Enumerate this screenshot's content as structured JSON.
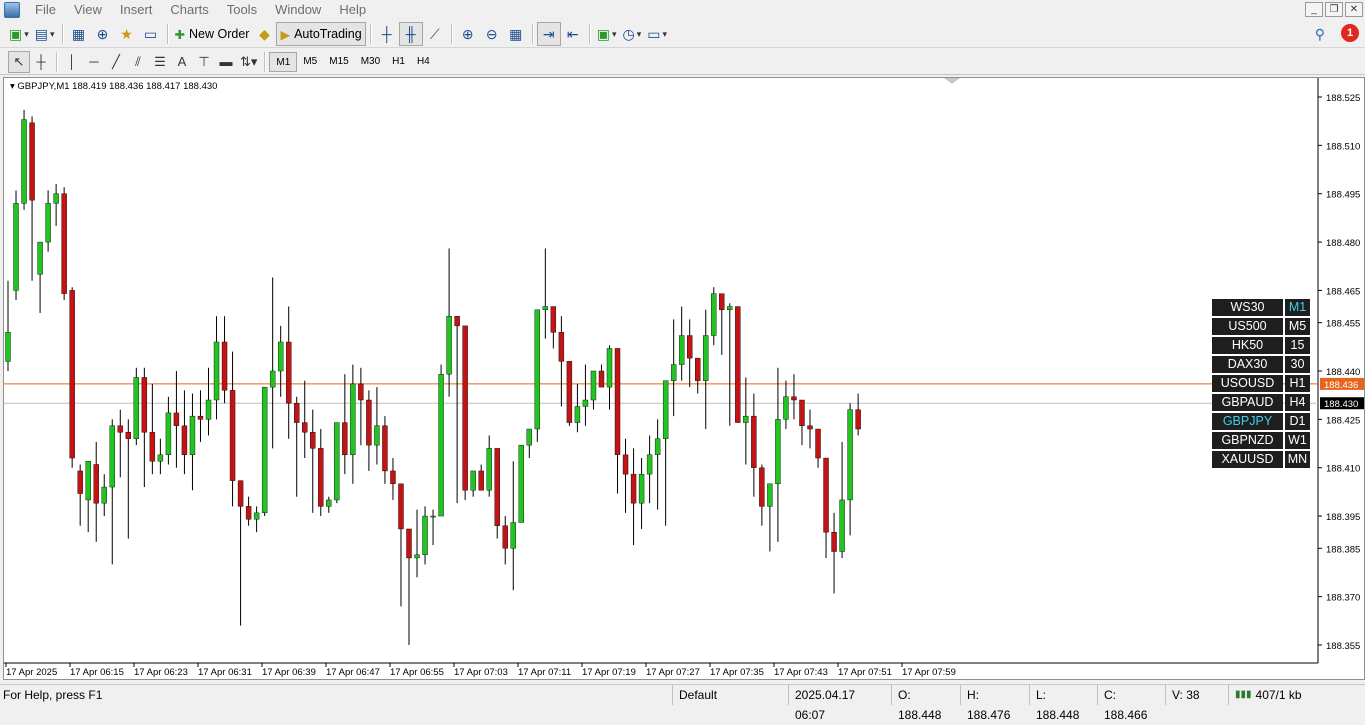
{
  "menu": [
    "File",
    "View",
    "Insert",
    "Charts",
    "Tools",
    "Window",
    "Help"
  ],
  "toolbar": {
    "new_order_label": "New Order",
    "autotrading_label": "AutoTrading",
    "alerts_count": "1"
  },
  "timeframes_toolbar": [
    "M1",
    "M5",
    "M15",
    "M30",
    "H1",
    "H4"
  ],
  "chart": {
    "title": "GBPJPY,M1  188.419 188.436 188.417 188.430",
    "bid_label": "188.436",
    "last_label": "188.430"
  },
  "chart_data": {
    "type": "candlestick",
    "symbol": "GBPJPY",
    "timeframe": "M1",
    "ohlc_header": {
      "open": 188.419,
      "high": 188.436,
      "low": 188.417,
      "close": 188.43
    },
    "y_ticks": [
      "188.525",
      "188.510",
      "188.495",
      "188.480",
      "188.465",
      "188.455",
      "188.440",
      "188.425",
      "188.410",
      "188.395",
      "188.385",
      "188.370",
      "188.355"
    ],
    "y_tick_values": [
      188.525,
      188.51,
      188.495,
      188.48,
      188.465,
      188.455,
      188.44,
      188.425,
      188.41,
      188.395,
      188.385,
      188.37,
      188.355
    ],
    "x_ticks": [
      "17 Apr 2025",
      "17 Apr 06:15",
      "17 Apr 06:23",
      "17 Apr 06:31",
      "17 Apr 06:39",
      "17 Apr 06:47",
      "17 Apr 06:55",
      "17 Apr 07:03",
      "17 Apr 07:11",
      "17 Apr 07:19",
      "17 Apr 07:27",
      "17 Apr 07:35",
      "17 Apr 07:43",
      "17 Apr 07:51",
      "17 Apr 07:59"
    ],
    "horizontal_lines": [
      {
        "name": "bid",
        "value": 188.436,
        "color": "#e8641e"
      },
      {
        "name": "last",
        "value": 188.43,
        "color": "#c0c0c0"
      }
    ],
    "colors": {
      "bull": "#22c422",
      "bear": "#c21414",
      "wick": "#000000"
    },
    "candles": [
      [
        188.443,
        188.468,
        188.452,
        188.44
      ],
      [
        188.465,
        188.496,
        188.492,
        188.462
      ],
      [
        188.492,
        188.521,
        188.518,
        188.49
      ],
      [
        188.517,
        188.519,
        188.493,
        188.468
      ],
      [
        188.47,
        188.479,
        188.48,
        188.458
      ],
      [
        188.48,
        188.496,
        188.492,
        188.477
      ],
      [
        188.492,
        188.498,
        188.495,
        188.485
      ],
      [
        188.495,
        188.497,
        188.464,
        188.462
      ],
      [
        188.465,
        188.466,
        188.413,
        188.41
      ],
      [
        188.409,
        188.411,
        188.402,
        188.392
      ],
      [
        188.4,
        188.412,
        188.412,
        188.39
      ],
      [
        188.411,
        188.418,
        188.399,
        188.387
      ],
      [
        188.399,
        188.408,
        188.404,
        188.395
      ],
      [
        188.404,
        188.425,
        188.423,
        188.38
      ],
      [
        188.423,
        188.428,
        188.421,
        188.407
      ],
      [
        188.421,
        188.425,
        188.419,
        188.388
      ],
      [
        188.419,
        188.441,
        188.438,
        188.417
      ],
      [
        188.438,
        188.441,
        188.421,
        188.404
      ],
      [
        188.421,
        188.436,
        188.412,
        188.408
      ],
      [
        188.412,
        188.419,
        188.414,
        188.408
      ],
      [
        188.414,
        188.432,
        188.427,
        188.411
      ],
      [
        188.427,
        188.44,
        188.423,
        188.41
      ],
      [
        188.423,
        188.434,
        188.414,
        188.408
      ],
      [
        188.414,
        188.433,
        188.426,
        188.403
      ],
      [
        188.426,
        188.434,
        188.425,
        188.418
      ],
      [
        188.425,
        188.441,
        188.431,
        188.42
      ],
      [
        188.431,
        188.457,
        188.449,
        188.425
      ],
      [
        188.449,
        188.457,
        188.434,
        188.43
      ],
      [
        188.434,
        188.446,
        188.406,
        188.398
      ],
      [
        188.406,
        188.405,
        188.398,
        188.361
      ],
      [
        188.398,
        188.401,
        188.394,
        188.392
      ],
      [
        188.394,
        188.398,
        188.396,
        188.39
      ],
      [
        188.396,
        188.423,
        188.435,
        188.395
      ],
      [
        188.435,
        188.469,
        188.44,
        188.416
      ],
      [
        188.44,
        188.454,
        188.449,
        188.432
      ],
      [
        188.449,
        188.46,
        188.43,
        188.419
      ],
      [
        188.43,
        188.432,
        188.424,
        188.401
      ],
      [
        188.424,
        188.437,
        188.421,
        188.413
      ],
      [
        188.421,
        188.428,
        188.416,
        188.396
      ],
      [
        188.416,
        188.422,
        188.398,
        188.395
      ],
      [
        188.398,
        188.401,
        188.4,
        188.396
      ],
      [
        188.4,
        188.414,
        188.424,
        188.399
      ],
      [
        188.424,
        188.439,
        188.414,
        188.408
      ],
      [
        188.414,
        188.442,
        188.436,
        188.405
      ],
      [
        188.436,
        188.441,
        188.431,
        188.417
      ],
      [
        188.431,
        188.434,
        188.417,
        188.409
      ],
      [
        188.417,
        188.435,
        188.423,
        188.411
      ],
      [
        188.423,
        188.426,
        188.409,
        188.405
      ],
      [
        188.409,
        188.413,
        188.405,
        188.4
      ],
      [
        188.405,
        188.399,
        188.391,
        188.367
      ],
      [
        188.391,
        188.39,
        188.382,
        188.355
      ],
      [
        188.382,
        188.397,
        188.383,
        188.376
      ],
      [
        188.383,
        188.398,
        188.395,
        188.38
      ],
      [
        188.395,
        188.397,
        188.395,
        188.386
      ],
      [
        188.395,
        188.442,
        188.439,
        188.401
      ],
      [
        188.439,
        188.478,
        188.457,
        188.432
      ],
      [
        188.457,
        188.453,
        188.454,
        188.399
      ],
      [
        188.454,
        188.437,
        188.403,
        188.4
      ],
      [
        188.403,
        188.405,
        188.409,
        188.401
      ],
      [
        188.409,
        188.411,
        188.403,
        188.403
      ],
      [
        188.403,
        188.42,
        188.416,
        188.401
      ],
      [
        188.416,
        188.414,
        188.392,
        188.388
      ],
      [
        188.392,
        188.395,
        188.385,
        188.38
      ],
      [
        188.385,
        188.412,
        188.393,
        188.372
      ],
      [
        188.393,
        188.412,
        188.417,
        188.405
      ],
      [
        188.417,
        188.42,
        188.422,
        188.413
      ],
      [
        188.422,
        188.439,
        188.459,
        188.418
      ],
      [
        188.459,
        188.478,
        188.46,
        188.45
      ],
      [
        188.46,
        188.446,
        188.452,
        188.447
      ],
      [
        188.452,
        188.457,
        188.443,
        188.429
      ],
      [
        188.443,
        188.443,
        188.424,
        188.423
      ],
      [
        188.424,
        188.436,
        188.429,
        188.421
      ],
      [
        188.429,
        188.442,
        188.431,
        188.423
      ],
      [
        188.431,
        188.44,
        188.44,
        188.428
      ],
      [
        188.44,
        188.442,
        188.435,
        188.435
      ],
      [
        188.435,
        188.448,
        188.447,
        188.428
      ],
      [
        188.447,
        188.446,
        188.414,
        188.402
      ],
      [
        188.414,
        188.419,
        188.408,
        188.396
      ],
      [
        188.408,
        188.416,
        188.399,
        188.386
      ],
      [
        188.399,
        188.413,
        188.408,
        188.391
      ],
      [
        188.408,
        188.42,
        188.414,
        188.399
      ],
      [
        188.414,
        188.425,
        188.419,
        188.397
      ],
      [
        188.419,
        188.432,
        188.437,
        188.392
      ],
      [
        188.437,
        188.456,
        188.442,
        188.426
      ],
      [
        188.442,
        188.46,
        188.451,
        188.437
      ],
      [
        188.451,
        188.456,
        188.444,
        188.435
      ],
      [
        188.444,
        188.441,
        188.437,
        188.433
      ],
      [
        188.437,
        188.459,
        188.451,
        188.422
      ],
      [
        188.451,
        188.466,
        188.464,
        188.448
      ],
      [
        188.464,
        188.463,
        188.459,
        188.445
      ],
      [
        188.459,
        188.461,
        188.46,
        188.423
      ],
      [
        188.46,
        188.448,
        188.424,
        188.425
      ],
      [
        188.424,
        188.438,
        188.426,
        188.411
      ],
      [
        188.426,
        188.433,
        188.41,
        188.401
      ],
      [
        188.41,
        188.411,
        188.398,
        188.392
      ],
      [
        188.398,
        188.398,
        188.405,
        188.384
      ],
      [
        188.405,
        188.441,
        188.425,
        188.387
      ],
      [
        188.425,
        188.437,
        188.432,
        188.422
      ],
      [
        188.432,
        188.439,
        188.431,
        188.425
      ],
      [
        188.431,
        188.428,
        188.423,
        188.417
      ],
      [
        188.423,
        188.428,
        188.422,
        188.416
      ],
      [
        188.422,
        188.42,
        188.413,
        188.41
      ],
      [
        188.413,
        188.411,
        188.39,
        188.382
      ],
      [
        188.39,
        188.396,
        188.384,
        188.371
      ],
      [
        188.384,
        188.418,
        188.4,
        188.382
      ],
      [
        188.4,
        188.43,
        188.428,
        188.389
      ],
      [
        188.428,
        188.433,
        188.422,
        188.42
      ]
    ]
  },
  "symbol_panel": [
    {
      "symbol": "WS30",
      "tf": "M1",
      "symbol_active": false,
      "tf_active": true
    },
    {
      "symbol": "US500",
      "tf": "M5",
      "symbol_active": false,
      "tf_active": false
    },
    {
      "symbol": "HK50",
      "tf": "15",
      "symbol_active": false,
      "tf_active": false
    },
    {
      "symbol": "DAX30",
      "tf": "30",
      "symbol_active": false,
      "tf_active": false
    },
    {
      "symbol": "USOUSD",
      "tf": "H1",
      "symbol_active": false,
      "tf_active": false
    },
    {
      "symbol": "GBPAUD",
      "tf": "H4",
      "symbol_active": false,
      "tf_active": false
    },
    {
      "symbol": "GBPJPY",
      "tf": "D1",
      "symbol_active": true,
      "tf_active": false
    },
    {
      "symbol": "GBPNZD",
      "tf": "W1",
      "symbol_active": false,
      "tf_active": false
    },
    {
      "symbol": "XAUUSD",
      "tf": "MN",
      "symbol_active": false,
      "tf_active": false
    }
  ],
  "status": {
    "help": "For Help, press F1",
    "profile": "Default",
    "datetime": "2025.04.17 06:07",
    "open": "O: 188.448",
    "high": "H: 188.476",
    "low": "L: 188.448",
    "close": "C: 188.466",
    "volume": "V: 38",
    "traffic": "407/1 kb"
  }
}
